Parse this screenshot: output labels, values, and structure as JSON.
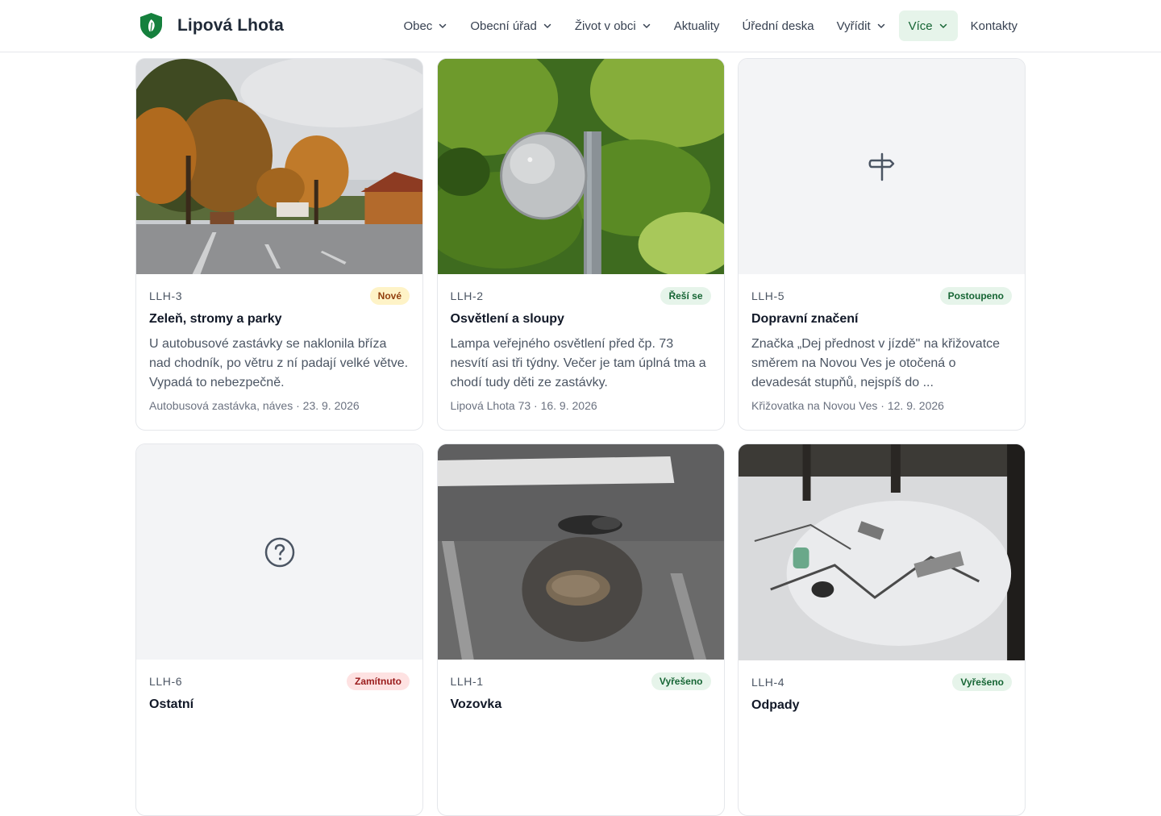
{
  "site": {
    "name": "Lipová Lhota",
    "brand_color": "#15803d"
  },
  "nav": [
    {
      "label": "Obec",
      "dropdown": true,
      "active": false
    },
    {
      "label": "Obecní úřad",
      "dropdown": true,
      "active": false
    },
    {
      "label": "Život v obci",
      "dropdown": true,
      "active": false
    },
    {
      "label": "Aktuality",
      "dropdown": false,
      "active": false
    },
    {
      "label": "Úřední deska",
      "dropdown": false,
      "active": false
    },
    {
      "label": "Vyřídit",
      "dropdown": true,
      "active": false
    },
    {
      "label": "Více",
      "dropdown": true,
      "active": true
    },
    {
      "label": "Kontakty",
      "dropdown": false,
      "active": false
    }
  ],
  "cards": [
    {
      "id": "LLH-3",
      "status": "Nové",
      "status_kind": "new",
      "title": "Zeleň, stromy a parky",
      "description": "U autobusové zastávky se naklonila bříza nad chodník, po větru z ní padají velké větve. Vypadá to nebezpečně.",
      "meta": "Autobusová zastávka, náves · 23. 9. 2026",
      "media": "photo-autumn-square"
    },
    {
      "id": "LLH-2",
      "status": "Řeší se",
      "status_kind": "progress",
      "title": "Osvětlení a sloupy",
      "description": "Lampa veřejného osvětlení před čp. 73 nesvítí asi tři týdny. Večer je tam úplná tma a chodí tudy děti ze zastávky.",
      "meta": "Lipová Lhota 73 · 16. 9. 2026",
      "media": "photo-street-lamp"
    },
    {
      "id": "LLH-5",
      "status": "Postoupeno",
      "status_kind": "forwarded",
      "title": "Dopravní značení",
      "description": "Značka „Dej přednost v jízdě\" na křižovatce směrem na Novou Ves je otočená o devadesát stupňů, nejspíš do ...",
      "meta": "Křižovatka na Novou Ves · 12. 9. 2026",
      "media": "signpost-icon"
    },
    {
      "id": "LLH-6",
      "status": "Zamítnuto",
      "status_kind": "rejected",
      "title": "Ostatní",
      "description": "",
      "meta": "",
      "media": "question-icon"
    },
    {
      "id": "LLH-1",
      "status": "Vyřešeno",
      "status_kind": "solved",
      "title": "Vozovka",
      "description": "",
      "meta": "",
      "media": "photo-pothole"
    },
    {
      "id": "LLH-4",
      "status": "Vyřešeno",
      "status_kind": "solved",
      "title": "Odpady",
      "description": "",
      "meta": "",
      "media": "photo-snow-waste"
    }
  ]
}
